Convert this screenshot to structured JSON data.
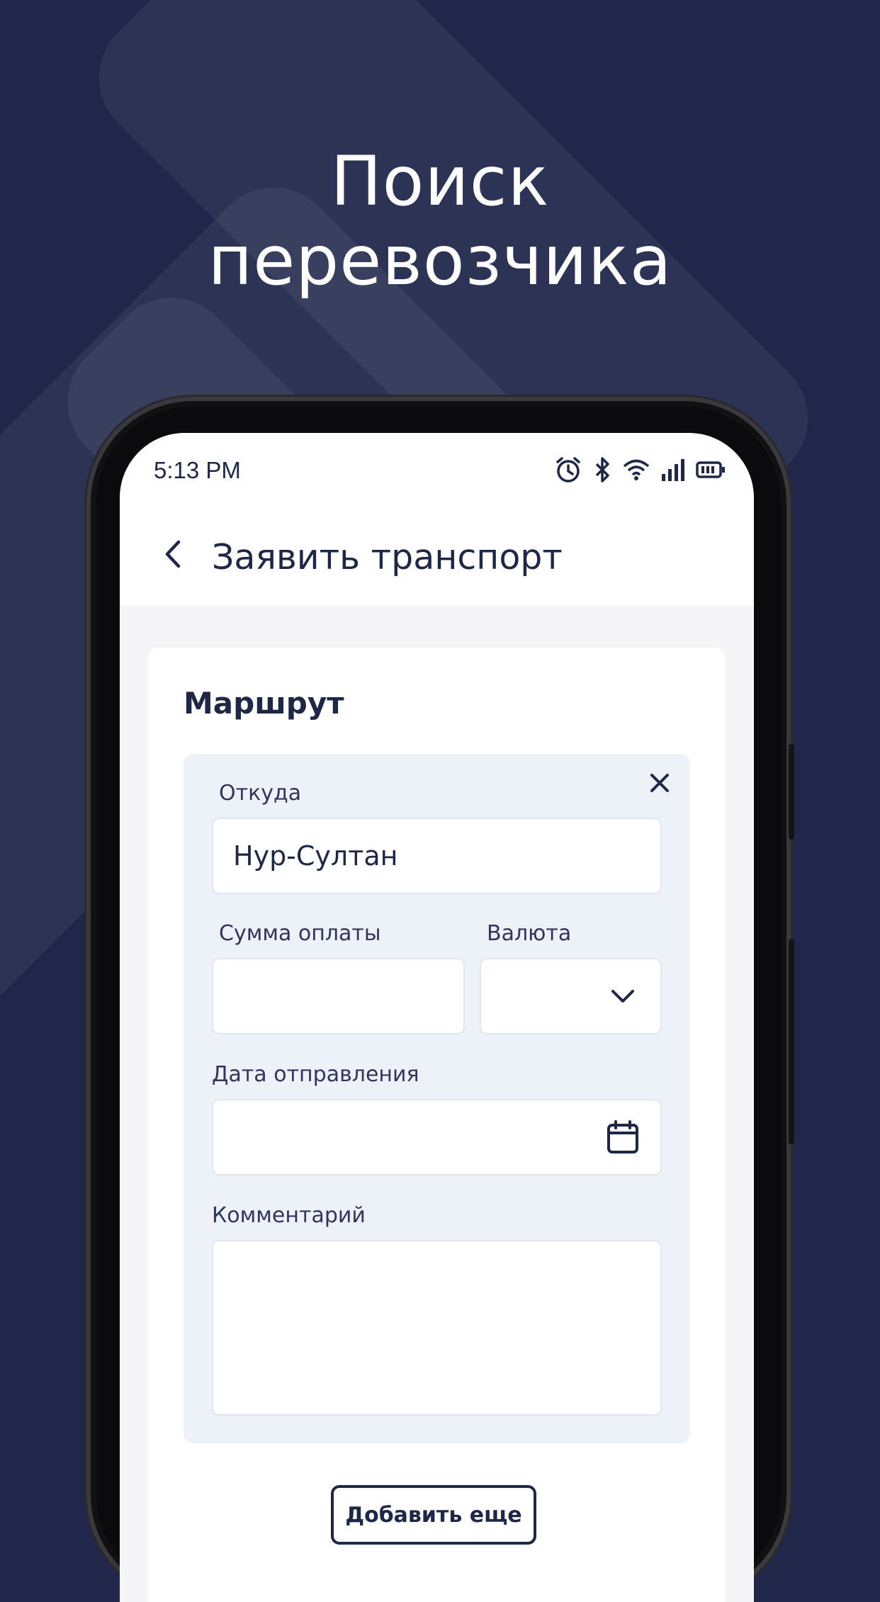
{
  "headline": {
    "line1": "Поиск",
    "line2": "перевозчика"
  },
  "status_bar": {
    "time": "5:13 PM"
  },
  "app_bar": {
    "title": "Заявить транспорт"
  },
  "section": {
    "title": "Маршрут"
  },
  "form": {
    "from": {
      "label": "Откуда",
      "value": "Нур-Султан"
    },
    "amount": {
      "label": "Сумма оплаты",
      "value": ""
    },
    "currency": {
      "label": "Валюта",
      "value": ""
    },
    "date": {
      "label": "Дата отправления",
      "value": ""
    },
    "comment": {
      "label": "Комментарий",
      "value": ""
    }
  },
  "actions": {
    "add_more": "Добавить еще"
  },
  "colors": {
    "background": "#20274a",
    "text_primary": "#1f2747",
    "route_box": "#edf2f9"
  },
  "icons": [
    "alarm-icon",
    "bluetooth-icon",
    "wifi-icon",
    "signal-icon",
    "battery-icon",
    "back-arrow-icon",
    "close-icon",
    "chevron-down-icon",
    "calendar-icon"
  ]
}
